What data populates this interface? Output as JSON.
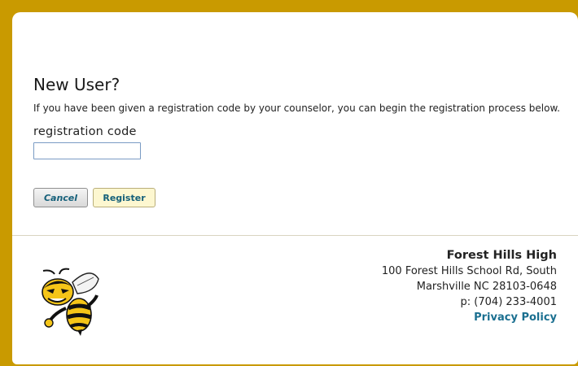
{
  "registration": {
    "heading": "New User?",
    "intro": "If you have been given a registration code by your counselor, you can begin the registration process below.",
    "field_label": "registration code",
    "code_value": "",
    "code_placeholder": "",
    "cancel_label": "Cancel",
    "register_label": "Register"
  },
  "footer": {
    "school_name": "Forest Hills High",
    "address_line1": "100 Forest Hills School Rd, South",
    "address_line2": "Marshville NC 28103-0648",
    "phone": "p: (704) 233-4001",
    "privacy_label": "Privacy Policy",
    "mascot_icon": "yellow-jacket-mascot-icon"
  },
  "colors": {
    "frame": "#c99a00",
    "link": "#1a6f90",
    "register_button_bg": "#fdf7d0"
  }
}
